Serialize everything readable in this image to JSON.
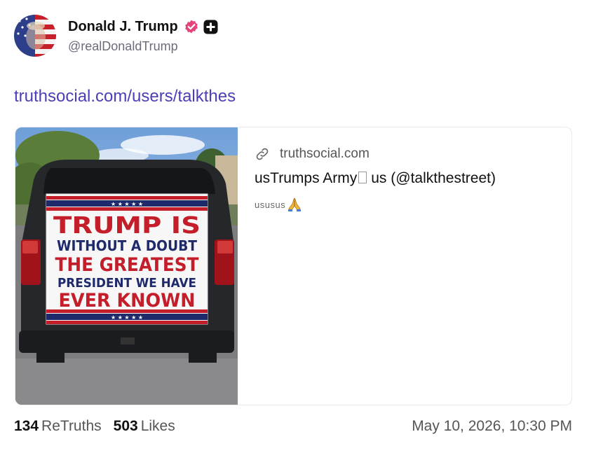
{
  "post": {
    "author": {
      "display_name": "Donald J. Trump",
      "handle": "@realDonaldTrump",
      "verified_icon": "verified-badge-icon",
      "verified_color": "#e3447e",
      "plus_icon": "plus-badge-icon"
    },
    "link_text": "truthsocial.com/users/talkthes",
    "card": {
      "domain": "truthsocial.com",
      "title_prefix": "usTrumps Army",
      "title_suffix": "us (@talkthestreet)",
      "description": "ususus",
      "description_icon": "praying-hands-icon",
      "image": {
        "sign_lines": [
          "TRUMP IS",
          "WITHOUT A DOUBT",
          "THE GREATEST",
          "PRESIDENT WE HAVE",
          "EVER KNOWN"
        ],
        "sign_stars": "★ ★ ★ ★ ★"
      }
    },
    "stats": {
      "retruths_count": "134",
      "retruths_label": "ReTruths",
      "likes_count": "503",
      "likes_label": "Likes"
    },
    "timestamp": "May 10, 2026, 10:30 PM"
  },
  "colors": {
    "link": "#4a3fb8",
    "sign_red": "#c41e2a",
    "sign_navy": "#1f2a6b"
  }
}
